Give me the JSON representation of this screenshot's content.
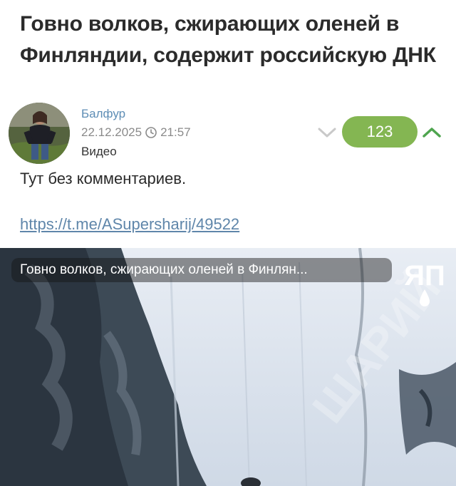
{
  "post": {
    "title": "Говно волков, сжирающих оленей в Финляндии, содержит российскую ДНК",
    "author": "Балфур",
    "date": "22.12.2025",
    "time": "21:57",
    "category": "Видео",
    "text": "Тут без комментариев.",
    "link": "https://t.me/ASupersharij/49522"
  },
  "rating": {
    "value": "123",
    "color": "#84b652",
    "up_icon": "chevron-up-icon",
    "down_icon": "chevron-down-icon"
  },
  "video": {
    "caption": "Говно волков, сжирающих оленей в Финлян...",
    "logo_text": "ЯП",
    "watermark": "ШАРИЙ"
  },
  "colors": {
    "author": "#5d8db5",
    "link": "#5f86aa",
    "rating_up": "#4fa54f"
  }
}
